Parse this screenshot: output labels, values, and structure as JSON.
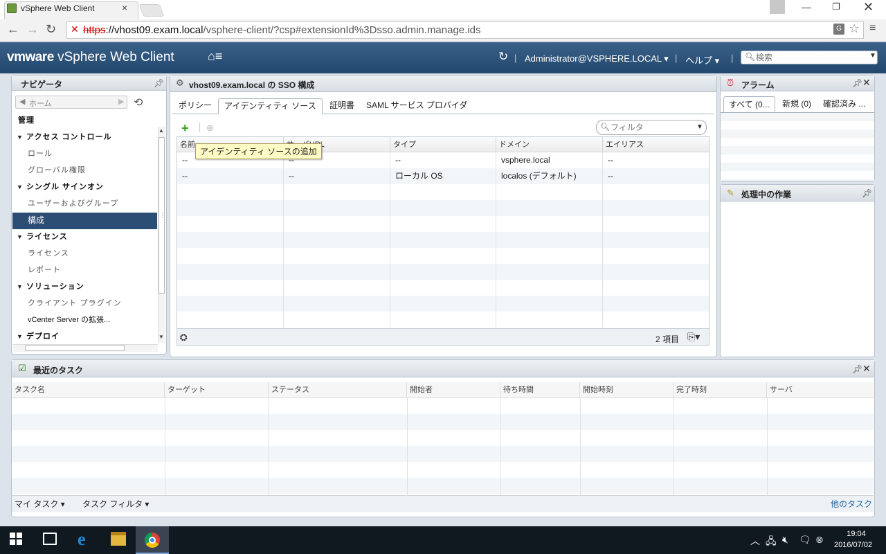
{
  "browser": {
    "tab_title": "vSphere Web Client",
    "url_scheme": "https",
    "url_host": "://vhost09.exam.local",
    "url_path": "/vsphere-client/?csp#extensionId%3Dsso.admin.manage.ids"
  },
  "header": {
    "brand_vm": "vmware",
    "brand_product": "vSphere Web Client",
    "user": "Administrator@VSPHERE.LOCAL ▾",
    "help": "ヘルプ ▾",
    "search_placeholder": "検索"
  },
  "navigator": {
    "title": "ナビゲータ",
    "home": "ホーム",
    "items": [
      {
        "label": "管理",
        "kind": "hdr",
        "caret": ""
      },
      {
        "label": "アクセス コントロール",
        "kind": "hdr",
        "caret": "▼"
      },
      {
        "label": "ロール",
        "kind": "child",
        "caret": ""
      },
      {
        "label": "グローバル権限",
        "kind": "child",
        "caret": ""
      },
      {
        "label": "シングル サインオン",
        "kind": "hdr",
        "caret": "▼"
      },
      {
        "label": "ユーザーおよびグループ",
        "kind": "child",
        "caret": ""
      },
      {
        "label": "構成",
        "kind": "selected",
        "caret": ""
      },
      {
        "label": "ライセンス",
        "kind": "hdr",
        "caret": "▼"
      },
      {
        "label": "ライセンス",
        "kind": "child",
        "caret": ""
      },
      {
        "label": "レポート",
        "kind": "child",
        "caret": ""
      },
      {
        "label": "ソリューション",
        "kind": "hdr",
        "caret": "▼"
      },
      {
        "label": "クライアント プラグイン",
        "kind": "child",
        "caret": ""
      },
      {
        "label": "vCenter Server の拡張...",
        "kind": "child-dark",
        "caret": ""
      },
      {
        "label": "デプロイ",
        "kind": "hdr",
        "caret": "▼"
      }
    ]
  },
  "main": {
    "title": "vhost09.exam.local の SSO 構成",
    "tabs": [
      "ポリシー",
      "アイデンティティ ソース",
      "証明書",
      "SAML サービス プロバイダ"
    ],
    "active_tab": 1,
    "filter_placeholder": "フィルタ",
    "tooltip": "アイデンティティ ソースの追加",
    "columns": [
      "名前",
      "サーバURL",
      "タイプ",
      "ドメイン",
      "エイリアス"
    ],
    "rows": [
      [
        "--",
        "--",
        "--",
        "vsphere.local",
        "--"
      ],
      [
        "--",
        "--",
        "ローカル OS",
        "localos (デフォルト)",
        "--"
      ]
    ],
    "item_count": "2 項目"
  },
  "alarms": {
    "title": "アラーム",
    "tabs": [
      "すべて (0...",
      "新規 (0)",
      "確認済み ..."
    ]
  },
  "work": {
    "title": "処理中の作業"
  },
  "tasks": {
    "title": "最近のタスク",
    "columns": [
      "タスク名",
      "ターゲット",
      "ステータス",
      "開始者",
      "待ち時間",
      "開始時刻",
      "完了時刻",
      "サーバ"
    ],
    "my_tasks": "マイ タスク ▾",
    "task_filter": "タスク フィルタ ▾",
    "more_tasks": "他のタスク"
  },
  "taskbar": {
    "time": "19:04",
    "date": "2016/07/02"
  }
}
